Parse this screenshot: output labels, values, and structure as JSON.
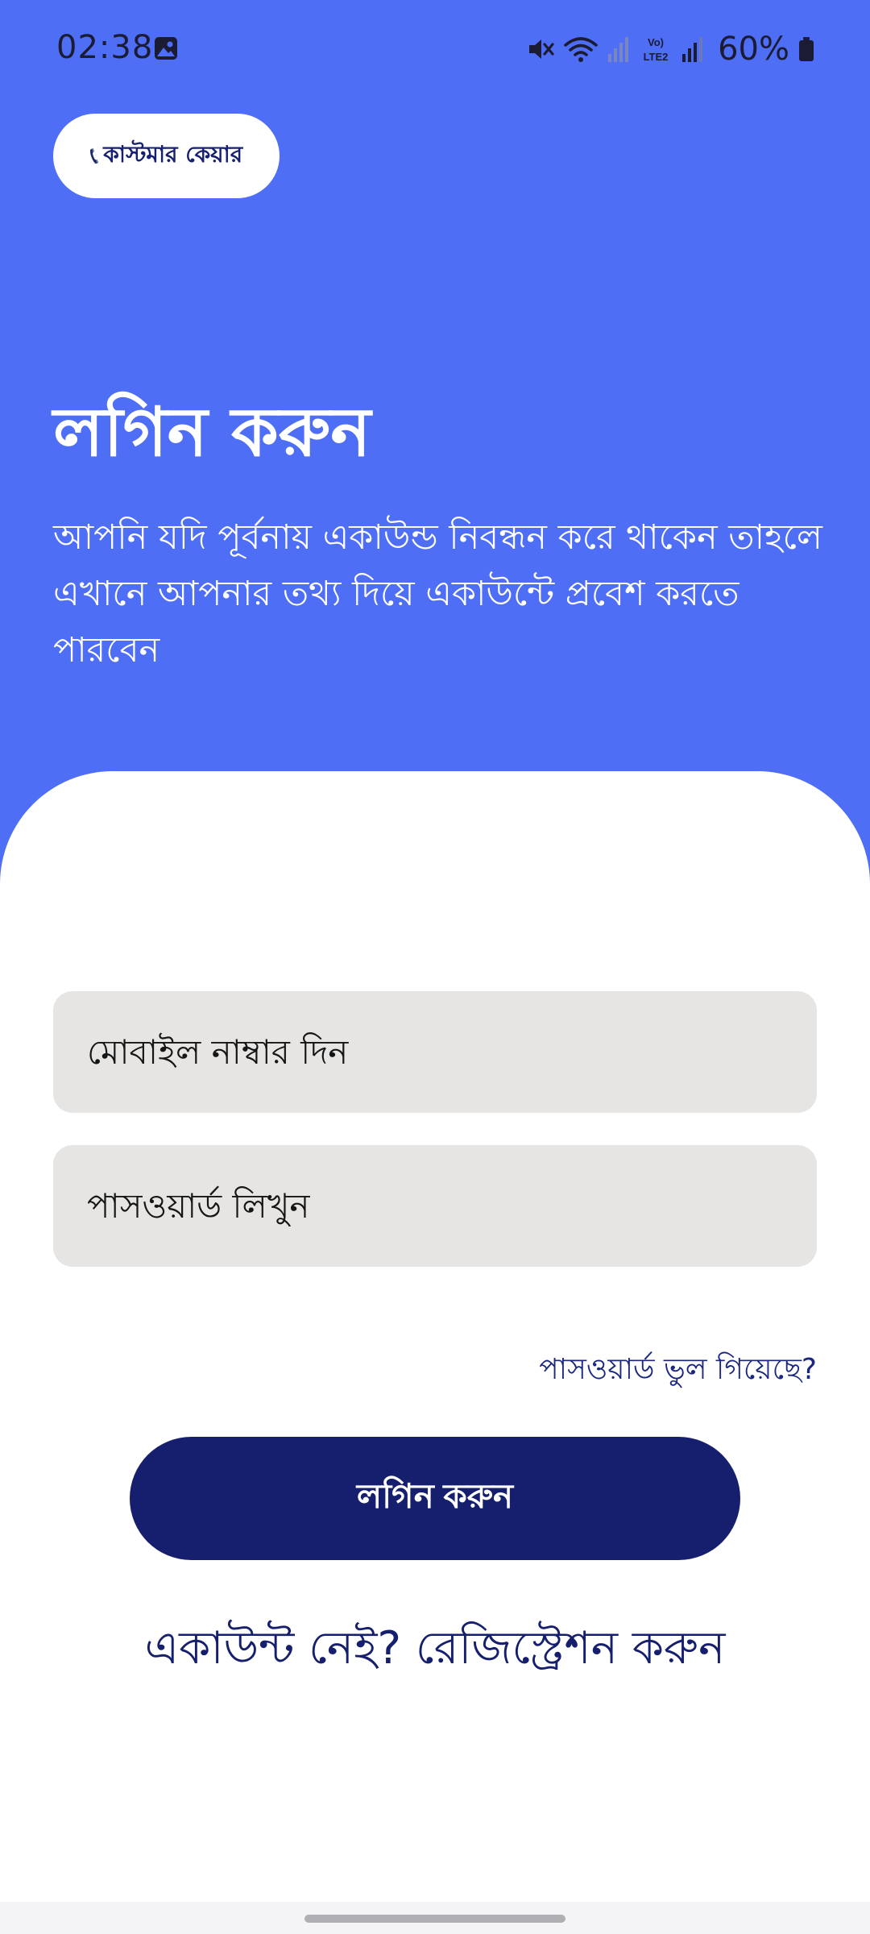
{
  "status_bar": {
    "time": "02:38",
    "battery": "60%",
    "network_label": "Vo) LTE2",
    "icons": [
      "gallery-icon",
      "mute-icon",
      "wifi-icon",
      "signal-icon",
      "lte-icon",
      "signal-icon",
      "battery-icon"
    ]
  },
  "customer_care": {
    "icon": "phone-icon",
    "label": "কাস্টমার কেয়ার"
  },
  "hero": {
    "title": "লগিন করুন",
    "subtitle": "আপনি যদি পূর্বনায় একাউন্ড নিবন্ধন করে থাকেন তাহলে এখানে আপনার তথ্য দিয়ে একাউন্টে প্রবেশ করতে পারবেন"
  },
  "form": {
    "phone_placeholder": "মোবাইল নাম্বার দিন",
    "password_placeholder": "পাসওয়ার্ড লিখুন",
    "forgot_label": "পাসওয়ার্ড ভুল গিয়েছে?",
    "login_label": "লগিন করুন",
    "register_label": "একাউন্ট নেই? রেজিস্ট্রেশন করুন"
  },
  "colors": {
    "header_blue": "#4f6ef6",
    "primary_dark": "#151f6e",
    "input_bg": "#e6e5e3"
  }
}
